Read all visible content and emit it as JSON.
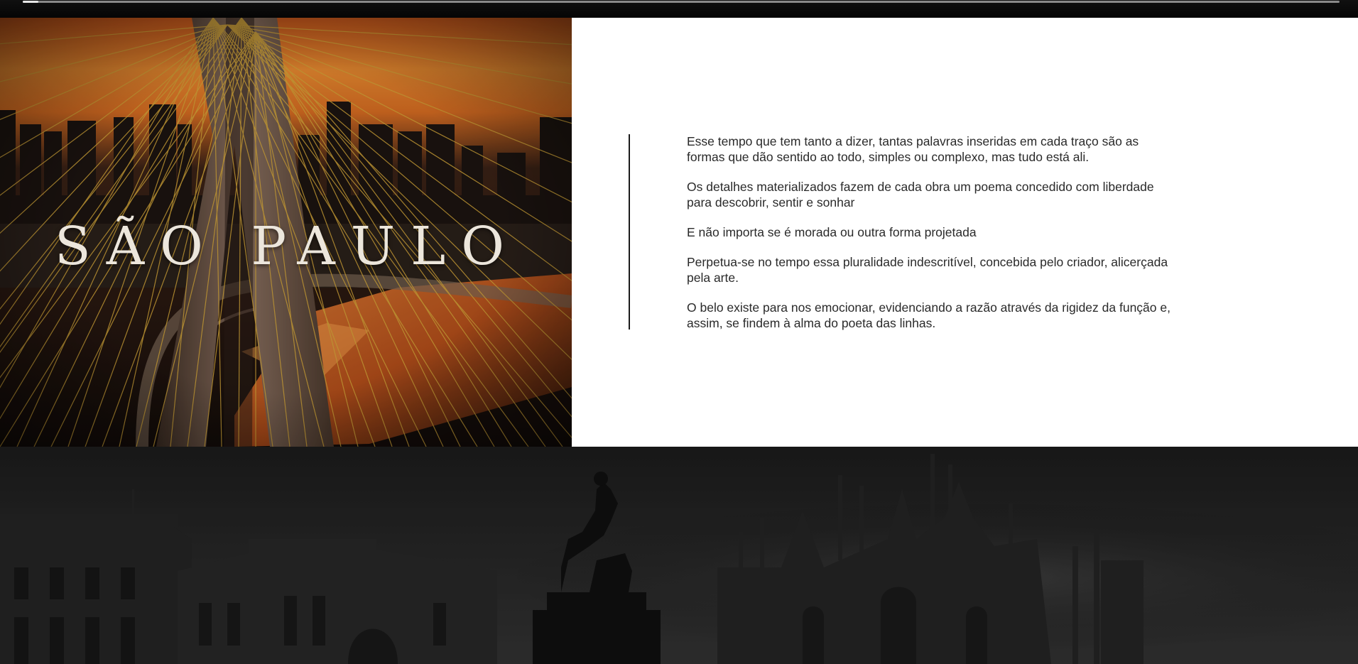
{
  "scroll_progress": {
    "value_percent": 1.2
  },
  "hero": {
    "title": "SÃO PAULO",
    "image_subject": "cable-stayed-bridge-sunset-photo"
  },
  "content": {
    "paragraphs": [
      "Esse tempo que tem tanto a dizer, tantas palavras inseridas em cada traço são as formas que dão sentido ao todo, simples ou complexo, mas tudo está ali.",
      "Os detalhes materializados fazem de cada obra um poema concedido com liberdade para descobrir, sentir e sonhar",
      "E não importa se é morada ou outra forma projetada",
      "Perpetua-se no tempo essa pluralidade indescritível, concebida pelo criador, alicerçada pela arte.",
      "O belo existe para nos emocionar, evidenciando a razão através da rigidez da função e, assim, se findem à alma do poeta das linhas."
    ]
  },
  "bottom": {
    "image_subject": "city-square-cathedral-statue-dark-photo"
  },
  "colors": {
    "text": "#2a2a2a",
    "title": "#ece6dc",
    "panel": "#ffffff",
    "sky_orange": "#e07a2a",
    "dark": "#000000"
  }
}
